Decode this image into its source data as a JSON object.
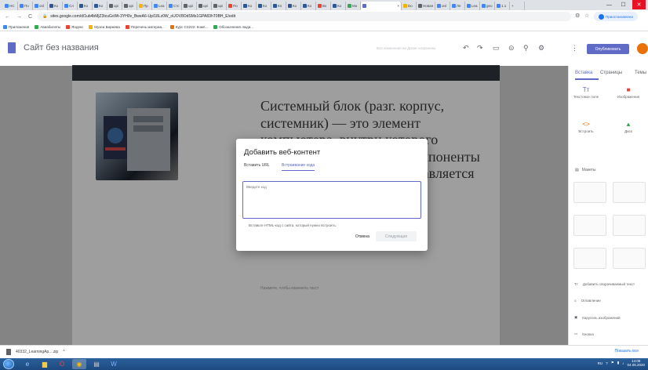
{
  "browser": {
    "tabs": [
      {
        "label": "НС",
        "color": "#4285f4"
      },
      {
        "label": "По",
        "color": "#4285f4"
      },
      {
        "label": "onl",
        "color": "#4285f4"
      },
      {
        "label": "Ко",
        "color": "#2b5797"
      },
      {
        "label": "Сл",
        "color": "#4285f4"
      },
      {
        "label": "Ко",
        "color": "#2b5797"
      },
      {
        "label": "Ко",
        "color": "#2b5797"
      },
      {
        "label": "upi",
        "color": "#5f6368"
      },
      {
        "label": "upi",
        "color": "#5f6368"
      },
      {
        "label": "Пр",
        "color": "#f4b400"
      },
      {
        "label": "Lea",
        "color": "#4285f4"
      },
      {
        "label": "Стс",
        "color": "#4285f4"
      },
      {
        "label": "upi",
        "color": "#5f6368"
      },
      {
        "label": "upi",
        "color": "#5f6368"
      },
      {
        "label": "upi",
        "color": "#5f6368"
      },
      {
        "label": "По",
        "color": "#ea4335"
      },
      {
        "label": "Ко",
        "color": "#2b5797"
      },
      {
        "label": "Ко",
        "color": "#2b5797"
      },
      {
        "label": "Кп",
        "color": "#2b5797"
      },
      {
        "label": "Ко",
        "color": "#2b5797"
      },
      {
        "label": "Ко",
        "color": "#2b5797"
      },
      {
        "label": "Вх",
        "color": "#ea4335"
      },
      {
        "label": "Ко",
        "color": "#2b5797"
      },
      {
        "label": "Мо",
        "color": "#34a853"
      },
      {
        "label": "",
        "color": "#5f6bc5",
        "active": true
      },
      {
        "label": "Do",
        "color": "#f4b400"
      },
      {
        "label": "Новая",
        "color": "#5f6368"
      },
      {
        "label": "onl",
        "color": "#4285f4"
      },
      {
        "label": "Ле",
        "color": "#4285f4"
      },
      {
        "label": "Lea",
        "color": "#4285f4"
      },
      {
        "label": "geo",
        "color": "#4285f4"
      },
      {
        "label": "1.1",
        "color": "#4285f4"
      }
    ],
    "new_tab_label": "+",
    "window_controls": {
      "minimize": "—",
      "maximize": "☐",
      "close": "✕"
    },
    "nav": {
      "back": "←",
      "forward": "→",
      "reload": "C"
    },
    "url": "sites.google.com/d/1ub4bMjZ3tcuGvWt-3YH0v_BweA6-Up/18Lz0W_oUOV8OdSMs1GPA83hT0BH_E/edit",
    "lock_icon": "lock-icon",
    "profile_label": "Приостановлена",
    "bookmarks": [
      {
        "label": "Приложения",
        "color": "#4285f4"
      },
      {
        "label": "Авиабилеты",
        "color": "#34a853"
      },
      {
        "label": "Яндекс",
        "color": "#ea4335"
      },
      {
        "label": "Музеи Биржева",
        "color": "#f4b400"
      },
      {
        "label": "Перечень материа...",
        "color": "#ea4335"
      },
      {
        "label": "Курс CS222: Комп...",
        "color": "#e8710a"
      },
      {
        "label": "Обозначения люда...",
        "color": "#34a853"
      }
    ]
  },
  "editor": {
    "site_title": "Сайт без названия",
    "saved_status": "Все изменения на Диске сохранены",
    "publish_label": "Опубликовать",
    "accent": "#5f6bc5",
    "panel_tabs": [
      "Вставка",
      "Страницы",
      "Темы"
    ],
    "insert_tiles": [
      {
        "icon": "Tт",
        "label": "Текстовое поле",
        "color": "#5f6bc5"
      },
      {
        "icon": "■",
        "label": "Изображения",
        "color": "#ea4335"
      },
      {
        "icon": "<>",
        "label": "Встроить",
        "color": "#e8710a"
      },
      {
        "icon": "▲",
        "label": "Диск",
        "color": "#34a853"
      }
    ],
    "layouts_label": "Макеты",
    "panel_items": [
      {
        "icon": "Tт",
        "label": "Добавить сворачиваемый текст"
      },
      {
        "icon": "≡",
        "label": "Оглавление"
      },
      {
        "icon": "▣",
        "label": "Карусель изображений"
      },
      {
        "icon": "▭",
        "label": "Кнопка"
      },
      {
        "icon": "—",
        "label": "Разделитель"
      }
    ]
  },
  "page": {
    "heading": "Системный блок (разг. корпус, системник) — это элемент компьютера, внутри которого расположены основные компоненты компьютера, в который вставляется",
    "placeholder": "Нажмите, чтобы изменить текст"
  },
  "dialog": {
    "title": "Добавить веб-контент",
    "tabs": [
      "Вставить URL",
      "Встраивание кода"
    ],
    "active_tab": 1,
    "code_placeholder": "Введите код",
    "hint": "Вставьте HTML-код с сайта, который нужно встроить.",
    "cancel_label": "Отмена",
    "next_label": "Следующая"
  },
  "downloads": {
    "file": "40332_LearningAp....zip",
    "chevron": "^",
    "show_all": "Показать все"
  },
  "taskbar": {
    "lang": "RU",
    "time": "14:08",
    "date": "04.06.2020"
  }
}
